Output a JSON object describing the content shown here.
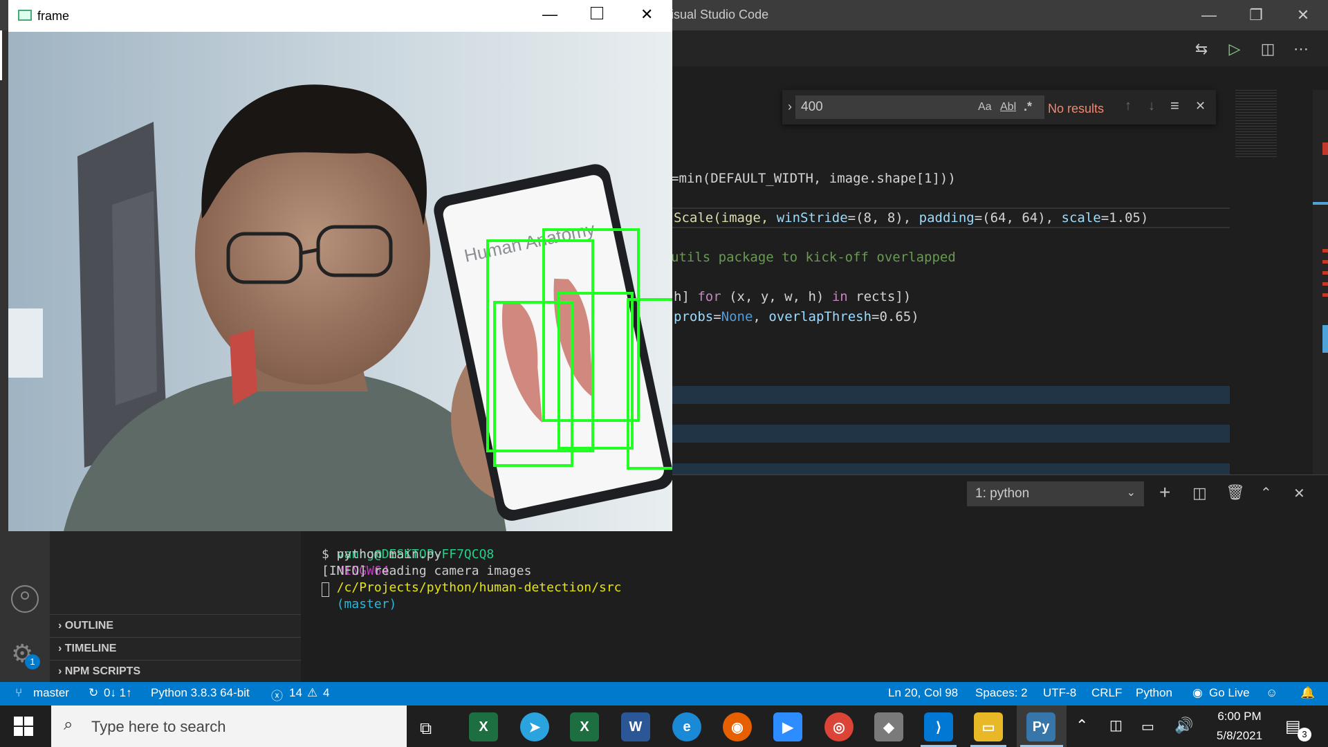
{
  "vscode": {
    "title_fragment": "isual Studio Code",
    "find": {
      "query": "400",
      "match_case": "Aa",
      "whole_word": "Abl",
      "regex": ".*",
      "result": "No results"
    },
    "code_lines": [
      {
        "segments": [
          {
            "t": "=min(DEFAULT_WIDTH, image.shape[1]))",
            "c": "#d4d4d4"
          }
        ]
      },
      {
        "segments": [
          {
            "t": "Scale(image, ",
            "c": "#dcdcaa"
          },
          {
            "t": "winStride",
            "c": "#9cdcfe"
          },
          {
            "t": "=(8, 8), ",
            "c": "#d4d4d4"
          },
          {
            "t": "padding",
            "c": "#9cdcfe"
          },
          {
            "t": "=(64, 64), ",
            "c": "#d4d4d4"
          },
          {
            "t": "scale",
            "c": "#9cdcfe"
          },
          {
            "t": "=1.05)",
            "c": "#d4d4d4"
          }
        ]
      },
      {
        "segments": [
          {
            "t": "utils package to kick-off overlapped",
            "c": "#6a9955"
          }
        ]
      },
      {
        "segments": [
          {
            "t": "h] ",
            "c": "#d4d4d4"
          },
          {
            "t": "for",
            "c": "#c586c0"
          },
          {
            "t": " (x, y, w, h) ",
            "c": "#d4d4d4"
          },
          {
            "t": "in",
            "c": "#c586c0"
          },
          {
            "t": " rects])",
            "c": "#d4d4d4"
          }
        ]
      },
      {
        "segments": [
          {
            "t": "probs",
            "c": "#9cdcfe"
          },
          {
            "t": "=",
            "c": "#d4d4d4"
          },
          {
            "t": "None",
            "c": "#569cd6"
          },
          {
            "t": ", ",
            "c": "#d4d4d4"
          },
          {
            "t": "overlapThresh",
            "c": "#9cdcfe"
          },
          {
            "t": "=0.65)",
            "c": "#d4d4d4"
          }
        ]
      }
    ],
    "terminal": {
      "selector": "1: python",
      "prompt_user": "vanng@DESKTOP-FF7QCQ8",
      "prompt_env": "MINGW64",
      "prompt_path": "/c/Projects/python/human-detection/src",
      "prompt_branch": "(master)",
      "command": "$ python main.py",
      "output": "[INFO] reading camera images"
    },
    "sidebar_sections": [
      "OUTLINE",
      "TIMELINE",
      "NPM SCRIPTS"
    ],
    "settings_badge": "1",
    "status": {
      "branch": "master",
      "sync": "0↓ 1↑",
      "python": "Python 3.8.3 64-bit",
      "errors": "14",
      "warnings": "4",
      "position": "Ln 20, Col 98",
      "spaces": "Spaces: 2",
      "encoding": "UTF-8",
      "eol": "CRLF",
      "language": "Python",
      "golive": "Go Live"
    }
  },
  "frame_window": {
    "title": "frame",
    "overlay_text": "Human Anatomy"
  },
  "taskbar": {
    "search_placeholder": "Type here to search",
    "time": "6:00 PM",
    "date": "5/8/2021",
    "notif_count": "3"
  }
}
